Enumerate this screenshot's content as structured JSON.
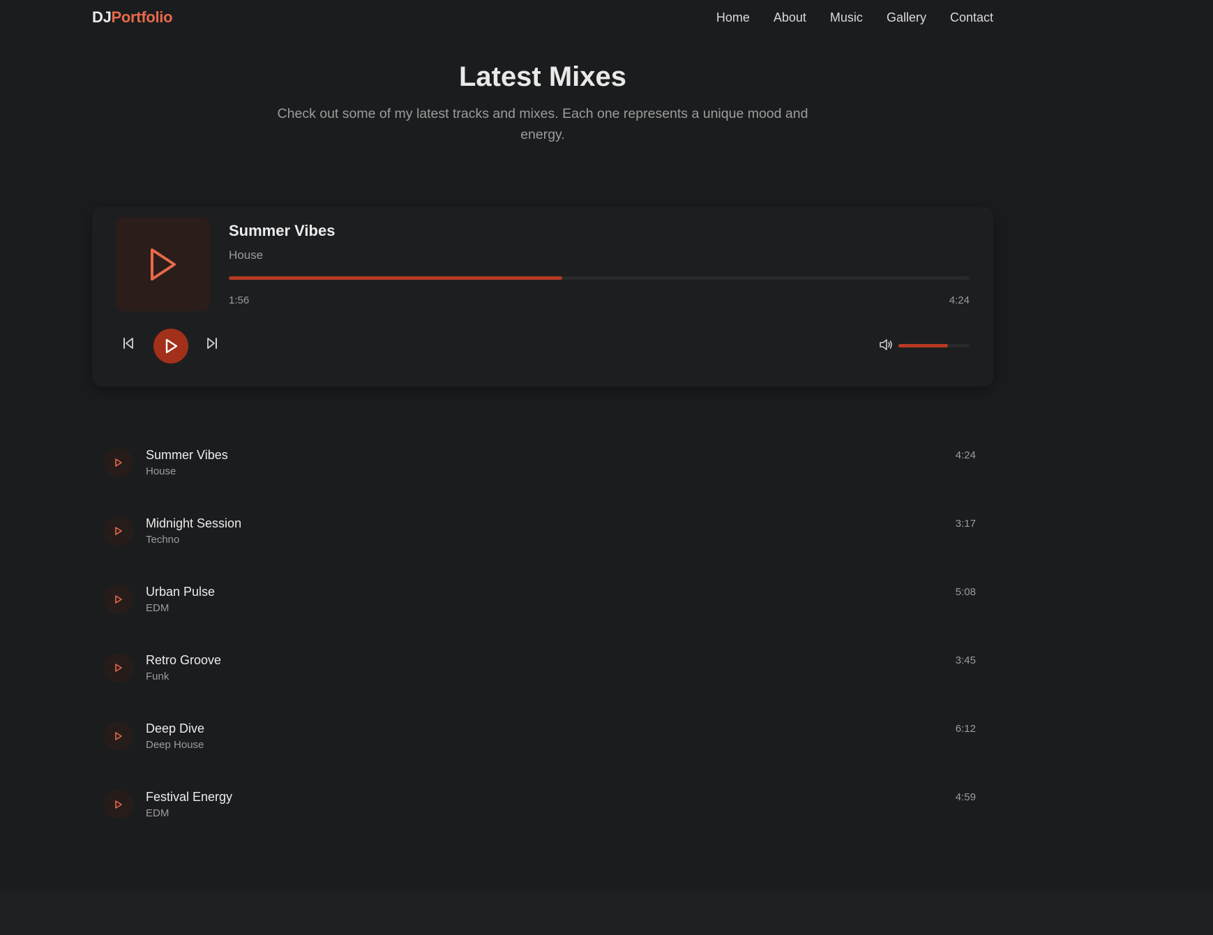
{
  "brand": {
    "prefix": "DJ",
    "name": "Portfolio",
    "accent": "#e8694a"
  },
  "nav": {
    "items": [
      {
        "label": "Home"
      },
      {
        "label": "About"
      },
      {
        "label": "Music"
      },
      {
        "label": "Gallery"
      },
      {
        "label": "Contact"
      }
    ]
  },
  "section": {
    "title": "Latest Mixes",
    "subtitle": "Check out some of my latest tracks and mixes. Each one represents a unique mood and energy."
  },
  "player": {
    "title": "Summer Vibes",
    "genre": "House",
    "current_time": "1:56",
    "total_time": "4:24",
    "progress_percent": 45,
    "volume_percent": 70,
    "icons": {
      "artwork": "play-icon",
      "prev": "skip-back-icon",
      "play": "play-icon",
      "next": "skip-forward-icon",
      "volume": "volume-icon"
    },
    "colors": {
      "accent": "#b63a22",
      "play_button": "#a3301a"
    }
  },
  "tracks": [
    {
      "title": "Summer Vibes",
      "genre": "House",
      "duration": "4:24"
    },
    {
      "title": "Midnight Session",
      "genre": "Techno",
      "duration": "3:17"
    },
    {
      "title": "Urban Pulse",
      "genre": "EDM",
      "duration": "5:08"
    },
    {
      "title": "Retro Groove",
      "genre": "Funk",
      "duration": "3:45"
    },
    {
      "title": "Deep Dive",
      "genre": "Deep House",
      "duration": "6:12"
    },
    {
      "title": "Festival Energy",
      "genre": "EDM",
      "duration": "4:59"
    }
  ]
}
